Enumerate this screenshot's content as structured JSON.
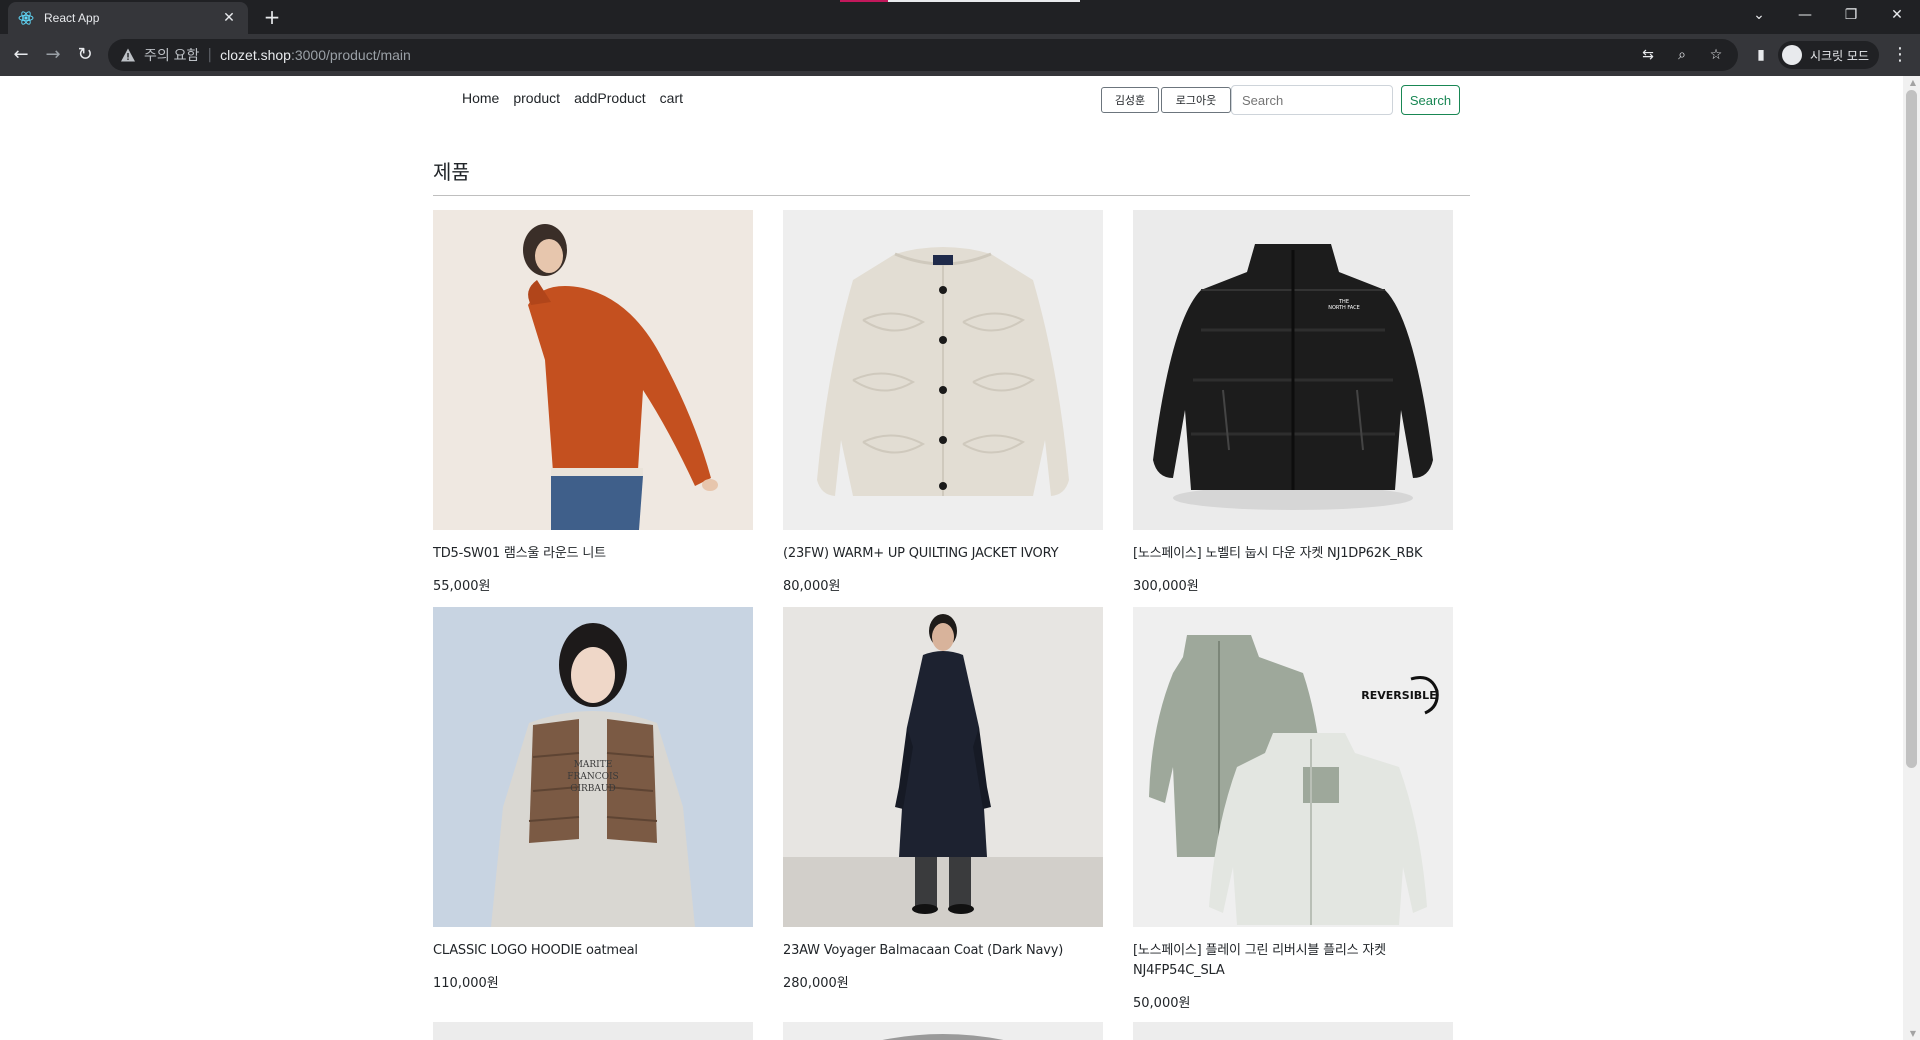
{
  "browser": {
    "tab_title": "React App",
    "warning_text": "주의 요함",
    "url_host": "clozet.shop",
    "url_rest": ":3000/product/main",
    "incognito_label": "시크릿 모드"
  },
  "navbar": {
    "links": [
      "Home",
      "product",
      "addProduct",
      "cart"
    ],
    "user_button": "김성훈",
    "logout_button": "로그아웃",
    "search_placeholder": "Search",
    "search_button": "Search"
  },
  "main": {
    "title": "제품",
    "products": [
      {
        "name": "TD5-SW01 램스울 라운드 니트",
        "price": "55,000원"
      },
      {
        "name": "(23FW) WARM+ UP QUILTING JACKET IVORY",
        "price": "80,000원"
      },
      {
        "name": "[노스페이스] 노벨티 눕시 다운 자켓 NJ1DP62K_RBK",
        "price": "300,000원"
      },
      {
        "name": "CLASSIC LOGO HOODIE oatmeal",
        "price": "110,000원"
      },
      {
        "name": "23AW Voyager Balmacaan Coat (Dark Navy)",
        "price": "280,000원"
      },
      {
        "name": "[노스페이스] 플레이 그린 리버시블 플리스 자켓 NJ4FP54C_SLA",
        "price": "50,000원",
        "badge": "REVERSIBLE"
      }
    ]
  }
}
